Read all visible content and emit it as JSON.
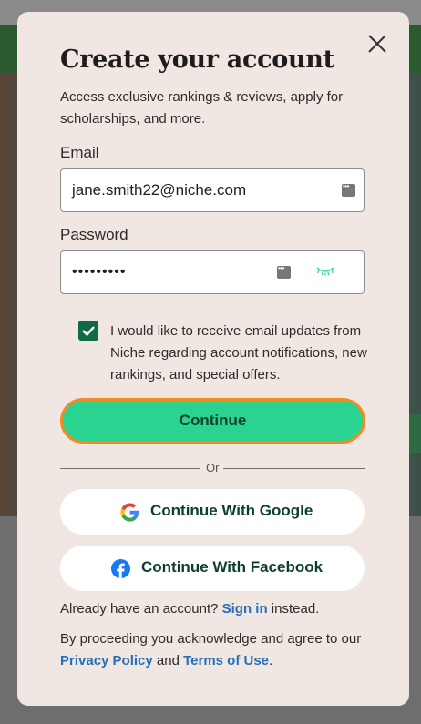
{
  "modal": {
    "title": "Create your account",
    "subtitle": "Access exclusive rankings & reviews, apply for scholarships, and more."
  },
  "email": {
    "label": "Email",
    "value": "jane.smith22@niche.com"
  },
  "password": {
    "label": "Password",
    "value": "•••••••••"
  },
  "opt_in": {
    "checked": true,
    "label": "I would like to receive email updates from Niche regarding account notifications, new rankings, and special offers."
  },
  "continue_label": "Continue",
  "divider_text": "Or",
  "google_label": "Continue With Google",
  "facebook_label": "Continue With Facebook",
  "signin": {
    "prefix": "Already have an account?",
    "link": "Sign in",
    "suffix": "instead."
  },
  "legal": {
    "prefix": "By proceeding you acknowledge and agree to our",
    "privacy_link": "Privacy Policy",
    "and": "and",
    "terms_link": "Terms of Use",
    "end": "."
  },
  "colors": {
    "accent_green": "#2ad38f",
    "focus_orange": "#f48a24",
    "link_blue": "#2a6eb8",
    "modal_bg": "#f1e7e2"
  },
  "icons": [
    "close-icon",
    "password-manager-icon",
    "eye-closed-icon",
    "check-icon",
    "google-icon",
    "facebook-icon"
  ]
}
